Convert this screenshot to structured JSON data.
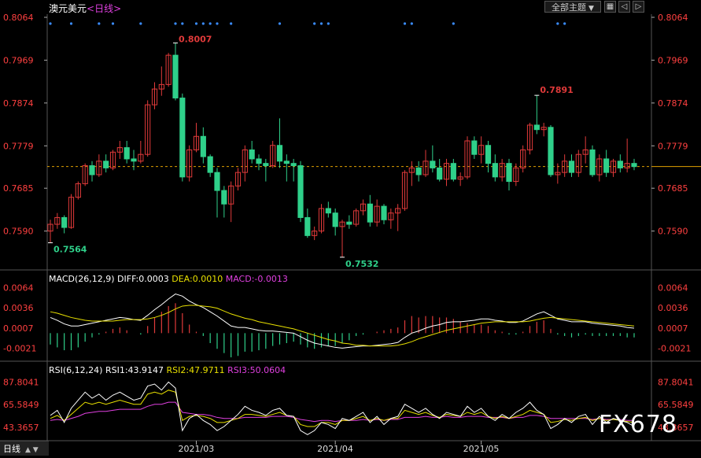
{
  "header": {
    "symbol": "澳元美元",
    "period": "<日线>",
    "theme_button": "全部主题",
    "theme_arrow": "▼",
    "icons": [
      "grid-icon",
      "left-arrow-icon",
      "right-arrow-icon"
    ]
  },
  "price_axis_labels": [
    "0.8064",
    "0.7969",
    "0.7874",
    "0.7779",
    "0.7685",
    "0.7590"
  ],
  "macd_label": {
    "name": "MACD(26,12,9)",
    "diff": "DIFF:0.0003",
    "dea": "DEA:0.0010",
    "macd": "MACD:-0.0013"
  },
  "macd_axis_labels": [
    "0.0064",
    "0.0036",
    "0.0007",
    "-0.0021"
  ],
  "rsi_label": {
    "name": "RSI(6,12,24)",
    "rsi1": "RSI1:43.9147",
    "rsi2": "RSI2:47.9711",
    "rsi3": "RSI3:50.0604"
  },
  "rsi_axis_labels": [
    "87.8041",
    "65.5849",
    "43.3657"
  ],
  "date_labels": [
    "2021/03",
    "2021/04",
    "2021/05"
  ],
  "annotations": {
    "high1": "0.8007",
    "low1": "0.7564",
    "low2": "0.7532",
    "high2": "0.7891"
  },
  "bottom_tab": {
    "label": "日线",
    "arrows": "▲ ▼"
  },
  "watermark": "FX678",
  "colors": {
    "up": "#e03a3a",
    "down": "#2fd08a",
    "diff": "#ffffff",
    "dea": "#e8e000",
    "rsi3": "#e040e0",
    "axis_text": "#ff4040",
    "ref_line": "#e0a000"
  },
  "chart_data": {
    "type": "candlestick",
    "reference_price": 0.7733,
    "price_range": [
      0.753,
      0.8064
    ],
    "ohlc": [
      [
        0.759,
        0.7615,
        0.7564,
        0.7605
      ],
      [
        0.7605,
        0.763,
        0.7595,
        0.762
      ],
      [
        0.762,
        0.7625,
        0.7585,
        0.7598
      ],
      [
        0.7598,
        0.7672,
        0.7595,
        0.7665
      ],
      [
        0.7665,
        0.77,
        0.766,
        0.7695
      ],
      [
        0.7695,
        0.774,
        0.769,
        0.7735
      ],
      [
        0.7735,
        0.7745,
        0.77,
        0.7715
      ],
      [
        0.7715,
        0.776,
        0.771,
        0.7745
      ],
      [
        0.7745,
        0.776,
        0.772,
        0.773
      ],
      [
        0.773,
        0.777,
        0.7725,
        0.7765
      ],
      [
        0.7765,
        0.779,
        0.775,
        0.7775
      ],
      [
        0.7775,
        0.779,
        0.774,
        0.775
      ],
      [
        0.775,
        0.777,
        0.7725,
        0.7745
      ],
      [
        0.7745,
        0.779,
        0.774,
        0.776
      ],
      [
        0.776,
        0.788,
        0.7755,
        0.787
      ],
      [
        0.787,
        0.792,
        0.786,
        0.7905
      ],
      [
        0.7905,
        0.7955,
        0.789,
        0.7915
      ],
      [
        0.7915,
        0.7985,
        0.791,
        0.798
      ],
      [
        0.798,
        0.8007,
        0.788,
        0.7885
      ],
      [
        0.7885,
        0.7895,
        0.77,
        0.771
      ],
      [
        0.771,
        0.778,
        0.77,
        0.777
      ],
      [
        0.777,
        0.783,
        0.7765,
        0.78
      ],
      [
        0.78,
        0.782,
        0.774,
        0.7755
      ],
      [
        0.7755,
        0.776,
        0.771,
        0.772
      ],
      [
        0.772,
        0.773,
        0.762,
        0.768
      ],
      [
        0.768,
        0.769,
        0.762,
        0.765
      ],
      [
        0.765,
        0.77,
        0.761,
        0.769
      ],
      [
        0.769,
        0.773,
        0.768,
        0.772
      ],
      [
        0.772,
        0.778,
        0.77,
        0.777
      ],
      [
        0.777,
        0.779,
        0.774,
        0.775
      ],
      [
        0.775,
        0.776,
        0.7725,
        0.774
      ],
      [
        0.774,
        0.775,
        0.77,
        0.7735
      ],
      [
        0.7735,
        0.779,
        0.773,
        0.778
      ],
      [
        0.778,
        0.784,
        0.773,
        0.7745
      ],
      [
        0.7745,
        0.776,
        0.77,
        0.774
      ],
      [
        0.774,
        0.775,
        0.77,
        0.7735
      ],
      [
        0.7735,
        0.7745,
        0.761,
        0.762
      ],
      [
        0.762,
        0.764,
        0.7575,
        0.758
      ],
      [
        0.758,
        0.76,
        0.757,
        0.759
      ],
      [
        0.759,
        0.765,
        0.7585,
        0.764
      ],
      [
        0.764,
        0.7655,
        0.762,
        0.763
      ],
      [
        0.763,
        0.764,
        0.758,
        0.76
      ],
      [
        0.76,
        0.7615,
        0.7532,
        0.761
      ],
      [
        0.761,
        0.7625,
        0.7595,
        0.7605
      ],
      [
        0.7605,
        0.764,
        0.76,
        0.7635
      ],
      [
        0.7635,
        0.766,
        0.7625,
        0.765
      ],
      [
        0.765,
        0.767,
        0.76,
        0.761
      ],
      [
        0.761,
        0.766,
        0.76,
        0.7645
      ],
      [
        0.7645,
        0.765,
        0.7605,
        0.7615
      ],
      [
        0.7615,
        0.764,
        0.7595,
        0.763
      ],
      [
        0.763,
        0.765,
        0.759,
        0.764
      ],
      [
        0.764,
        0.7725,
        0.7635,
        0.772
      ],
      [
        0.772,
        0.7745,
        0.769,
        0.773
      ],
      [
        0.773,
        0.7745,
        0.77,
        0.7715
      ],
      [
        0.7715,
        0.777,
        0.771,
        0.7745
      ],
      [
        0.7745,
        0.778,
        0.772,
        0.773
      ],
      [
        0.773,
        0.775,
        0.77,
        0.7705
      ],
      [
        0.7705,
        0.775,
        0.769,
        0.774
      ],
      [
        0.774,
        0.775,
        0.77,
        0.7705
      ],
      [
        0.7705,
        0.772,
        0.769,
        0.771
      ],
      [
        0.771,
        0.78,
        0.7705,
        0.779
      ],
      [
        0.779,
        0.78,
        0.775,
        0.776
      ],
      [
        0.776,
        0.78,
        0.774,
        0.778
      ],
      [
        0.778,
        0.779,
        0.772,
        0.774
      ],
      [
        0.774,
        0.776,
        0.77,
        0.771
      ],
      [
        0.771,
        0.775,
        0.77,
        0.774
      ],
      [
        0.774,
        0.775,
        0.768,
        0.77
      ],
      [
        0.77,
        0.774,
        0.769,
        0.773
      ],
      [
        0.773,
        0.778,
        0.772,
        0.777
      ],
      [
        0.777,
        0.783,
        0.776,
        0.7825
      ],
      [
        0.7825,
        0.7891,
        0.7805,
        0.7815
      ],
      [
        0.7815,
        0.783,
        0.78,
        0.782
      ],
      [
        0.782,
        0.7825,
        0.771,
        0.7715
      ],
      [
        0.7715,
        0.774,
        0.7695,
        0.772
      ],
      [
        0.772,
        0.776,
        0.771,
        0.7745
      ],
      [
        0.7745,
        0.776,
        0.771,
        0.772
      ],
      [
        0.772,
        0.777,
        0.771,
        0.776
      ],
      [
        0.776,
        0.78,
        0.774,
        0.777
      ],
      [
        0.777,
        0.778,
        0.771,
        0.7715
      ],
      [
        0.7715,
        0.776,
        0.77,
        0.775
      ],
      [
        0.775,
        0.777,
        0.771,
        0.772
      ],
      [
        0.772,
        0.775,
        0.771,
        0.7745
      ],
      [
        0.7745,
        0.776,
        0.772,
        0.773
      ],
      [
        0.773,
        0.7795,
        0.772,
        0.774
      ],
      [
        0.774,
        0.775,
        0.7725,
        0.7733
      ]
    ],
    "macd_range": [
      -0.0035,
      0.007
    ],
    "diff": [
      0.0022,
      0.0018,
      0.0013,
      0.001,
      0.001,
      0.0012,
      0.0014,
      0.0016,
      0.0018,
      0.002,
      0.0022,
      0.0021,
      0.0019,
      0.0018,
      0.0025,
      0.0033,
      0.004,
      0.0048,
      0.0055,
      0.0052,
      0.0045,
      0.004,
      0.0036,
      0.003,
      0.0024,
      0.0017,
      0.001,
      0.0008,
      0.0008,
      0.0006,
      0.0004,
      0.0003,
      0.0003,
      0.0002,
      0.0001,
      0.0,
      -0.0005,
      -0.001,
      -0.0014,
      -0.0016,
      -0.0018,
      -0.002,
      -0.0021,
      -0.002,
      -0.0019,
      -0.0018,
      -0.0018,
      -0.0017,
      -0.0016,
      -0.0015,
      -0.0013,
      -0.0006,
      0.0,
      0.0003,
      0.0007,
      0.001,
      0.0012,
      0.0015,
      0.0016,
      0.0016,
      0.0017,
      0.0018,
      0.002,
      0.002,
      0.0018,
      0.0017,
      0.0015,
      0.0015,
      0.0017,
      0.0022,
      0.0027,
      0.003,
      0.0025,
      0.002,
      0.0018,
      0.0016,
      0.0016,
      0.0016,
      0.0014,
      0.0013,
      0.0012,
      0.0011,
      0.001,
      0.0008,
      0.0007
    ],
    "dea": [
      0.003,
      0.0028,
      0.0025,
      0.0022,
      0.002,
      0.0018,
      0.0017,
      0.0017,
      0.0017,
      0.0017,
      0.0018,
      0.0019,
      0.0019,
      0.0019,
      0.002,
      0.0022,
      0.0025,
      0.0029,
      0.0034,
      0.0038,
      0.0039,
      0.0039,
      0.0038,
      0.0037,
      0.0035,
      0.0031,
      0.0027,
      0.0024,
      0.0021,
      0.0019,
      0.0016,
      0.0014,
      0.0012,
      0.001,
      0.0008,
      0.0006,
      0.0003,
      0.0,
      -0.0003,
      -0.0006,
      -0.0009,
      -0.0011,
      -0.0014,
      -0.0015,
      -0.0017,
      -0.0017,
      -0.0018,
      -0.0018,
      -0.0018,
      -0.0018,
      -0.0017,
      -0.0015,
      -0.0012,
      -0.0008,
      -0.0005,
      -0.0002,
      0.0001,
      0.0004,
      0.0006,
      0.0008,
      0.001,
      0.0012,
      0.0014,
      0.0015,
      0.0016,
      0.0016,
      0.0016,
      0.0016,
      0.0016,
      0.0017,
      0.0019,
      0.0021,
      0.0022,
      0.0021,
      0.002,
      0.0019,
      0.0018,
      0.0017,
      0.0016,
      0.0015,
      0.0014,
      0.0013,
      0.0012,
      0.0011,
      0.001
    ],
    "rsi_range": [
      30,
      100
    ],
    "rsi1": [
      55,
      60,
      48,
      62,
      70,
      78,
      72,
      76,
      70,
      75,
      78,
      74,
      70,
      72,
      84,
      86,
      80,
      88,
      82,
      40,
      52,
      56,
      50,
      46,
      40,
      44,
      50,
      56,
      64,
      60,
      58,
      55,
      60,
      62,
      55,
      54,
      40,
      36,
      40,
      48,
      46,
      42,
      52,
      50,
      54,
      58,
      48,
      54,
      46,
      52,
      54,
      66,
      62,
      58,
      62,
      56,
      52,
      58,
      56,
      54,
      64,
      58,
      62,
      54,
      50,
      56,
      52,
      58,
      62,
      68,
      60,
      56,
      42,
      46,
      52,
      48,
      54,
      56,
      46,
      54,
      48,
      52,
      50,
      48,
      44
    ],
    "rsi2": [
      52,
      55,
      50,
      56,
      62,
      68,
      66,
      68,
      66,
      68,
      70,
      68,
      66,
      66,
      76,
      78,
      76,
      80,
      78,
      50,
      54,
      55,
      54,
      52,
      48,
      48,
      50,
      52,
      56,
      56,
      55,
      54,
      56,
      58,
      55,
      54,
      46,
      44,
      44,
      48,
      48,
      46,
      50,
      50,
      52,
      54,
      50,
      52,
      50,
      52,
      52,
      60,
      58,
      56,
      58,
      55,
      53,
      56,
      55,
      54,
      58,
      56,
      58,
      54,
      52,
      54,
      52,
      54,
      56,
      60,
      58,
      56,
      48,
      49,
      51,
      50,
      52,
      53,
      50,
      52,
      50,
      51,
      50,
      49,
      48
    ],
    "rsi3": [
      50,
      51,
      50,
      52,
      54,
      57,
      58,
      59,
      59,
      60,
      61,
      61,
      61,
      61,
      64,
      66,
      66,
      68,
      68,
      58,
      57,
      56,
      56,
      55,
      53,
      52,
      52,
      52,
      53,
      53,
      53,
      53,
      54,
      54,
      54,
      53,
      51,
      50,
      49,
      50,
      50,
      49,
      50,
      50,
      50,
      51,
      50,
      51,
      50,
      51,
      51,
      53,
      53,
      53,
      54,
      53,
      53,
      54,
      53,
      53,
      54,
      54,
      54,
      53,
      53,
      53,
      52,
      53,
      53,
      55,
      55,
      54,
      52,
      52,
      52,
      52,
      52,
      52,
      51,
      52,
      51,
      51,
      51,
      50,
      50
    ]
  }
}
